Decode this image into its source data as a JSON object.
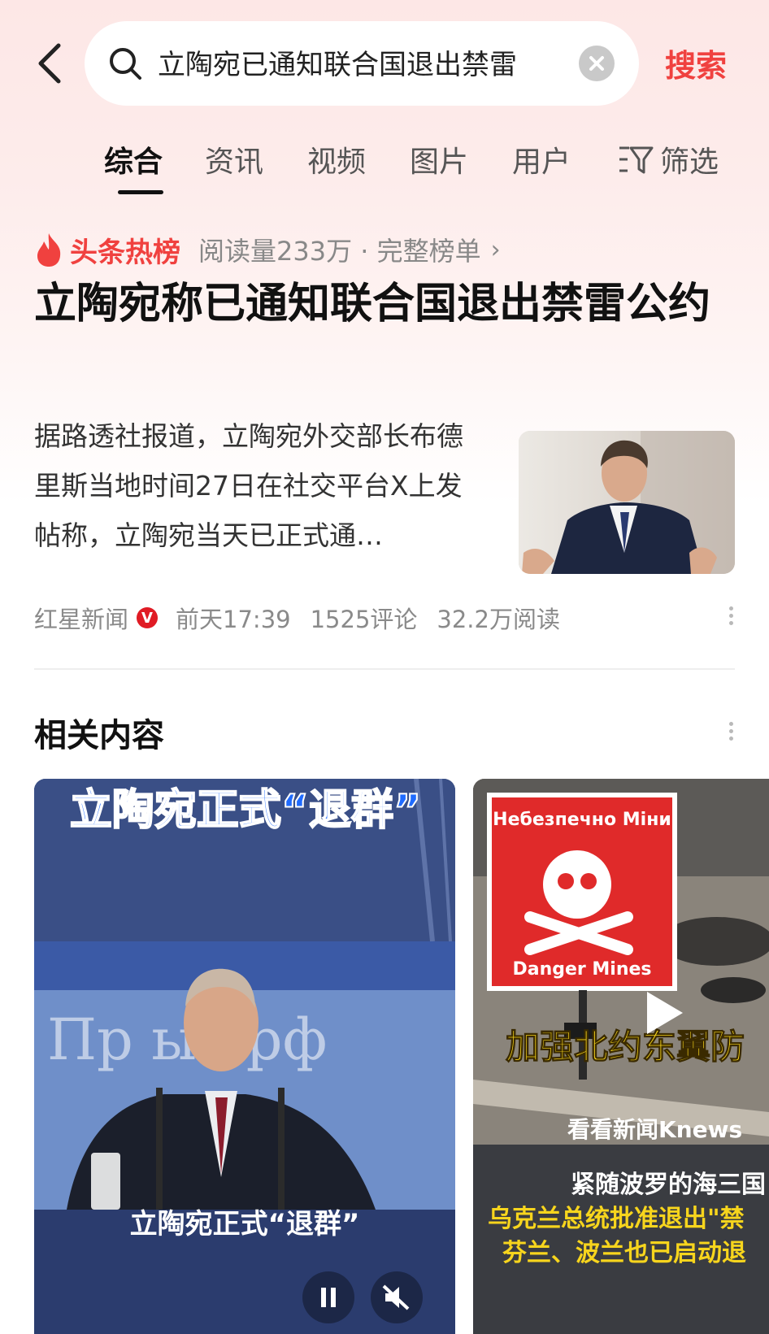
{
  "search": {
    "query": "立陶宛已通知联合国退出禁雷",
    "button_label": "搜索"
  },
  "tabs": [
    {
      "label": "综合"
    },
    {
      "label": "资讯"
    },
    {
      "label": "视频"
    },
    {
      "label": "图片"
    },
    {
      "label": "用户"
    }
  ],
  "filter_label": "筛选",
  "hotlist": {
    "title": "头条热榜",
    "meta": "阅读量233万 · 完整榜单"
  },
  "article": {
    "headline": "立陶宛称已通知联合国退出禁雷公约",
    "summary": "据路透社报道，立陶宛外交部长布德里斯当地时间27日在社交平台X上发帖称，立陶宛当天已正式通…",
    "source": "红星新闻",
    "verified_badge": "V",
    "time": "前天17:39",
    "comments": "1525评论",
    "reads": "32.2万阅读"
  },
  "related": {
    "title": "相关内容",
    "cards": [
      {
        "top_caption": "立陶宛正式“退群”",
        "bg_text": "Пр    ыт.рф",
        "bottom_caption": "立陶宛正式“退群”"
      },
      {
        "sign_top": "Небезпечно Міни",
        "sign_bottom": "Danger Mines",
        "overlay": "加强北约东翼防",
        "logo": "看看新闻Knews",
        "line1": "紧随波罗的海三国",
        "line2": "乌克兰总统批准退出\"禁",
        "line3": "芬兰、波兰也已启动退"
      }
    ]
  },
  "colors": {
    "accent": "#f0413f",
    "badge": "#e01b24",
    "card1_caption": "#1f6bff",
    "card2_caption": "#f7d51d"
  }
}
